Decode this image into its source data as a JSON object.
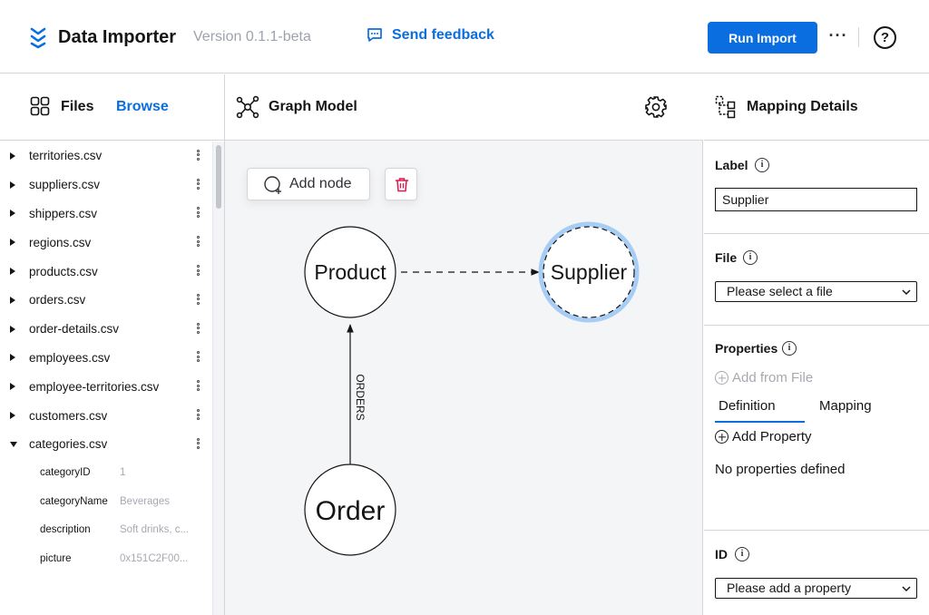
{
  "header": {
    "app_title": "Data Importer",
    "version": "Version 0.1.1-beta",
    "feedback_label": "Send feedback",
    "run_label": "Run Import",
    "more_label": "···",
    "help_label": "?"
  },
  "files_panel": {
    "title": "Files",
    "browse_label": "Browse",
    "files": [
      {
        "name": "territories.csv",
        "expanded": false
      },
      {
        "name": "suppliers.csv",
        "expanded": false
      },
      {
        "name": "shippers.csv",
        "expanded": false
      },
      {
        "name": "regions.csv",
        "expanded": false
      },
      {
        "name": "products.csv",
        "expanded": false
      },
      {
        "name": "orders.csv",
        "expanded": false
      },
      {
        "name": "order-details.csv",
        "expanded": false
      },
      {
        "name": "employees.csv",
        "expanded": false
      },
      {
        "name": "employee-territories.csv",
        "expanded": false
      },
      {
        "name": "customers.csv",
        "expanded": false
      },
      {
        "name": "categories.csv",
        "expanded": true
      }
    ],
    "columns": [
      {
        "name": "categoryID",
        "sample": "1"
      },
      {
        "name": "categoryName",
        "sample": "Beverages"
      },
      {
        "name": "description",
        "sample": "Soft drinks, c..."
      },
      {
        "name": "picture",
        "sample": "0x151C2F00..."
      }
    ]
  },
  "graph_panel": {
    "title": "Graph Model",
    "add_node_label": "Add node",
    "nodes": [
      {
        "id": "product",
        "label": "Product",
        "selected": false
      },
      {
        "id": "supplier",
        "label": "Supplier",
        "selected": true
      },
      {
        "id": "order",
        "label": "Order",
        "selected": false
      }
    ],
    "relationships": [
      {
        "from": "order",
        "to": "product",
        "label": "ORDERS",
        "style": "solid"
      },
      {
        "from": "product",
        "to": "supplier",
        "label": "",
        "style": "dashed"
      }
    ]
  },
  "mapping_panel": {
    "title": "Mapping Details",
    "label_section": {
      "title": "Label",
      "value": "Supplier"
    },
    "file_section": {
      "title": "File",
      "selected": "Please select a file"
    },
    "properties_section": {
      "title": "Properties",
      "add_from_file": "Add from File",
      "tabs": [
        "Definition",
        "Mapping"
      ],
      "active_tab": "Definition",
      "add_property": "Add Property",
      "empty_text": "No properties defined"
    },
    "id_section": {
      "title": "ID",
      "selected": "Please add a property"
    }
  },
  "colors": {
    "accent": "#0a6ee0",
    "selection_ring": "#a8cdf5",
    "delete_red": "#d81b4a"
  }
}
